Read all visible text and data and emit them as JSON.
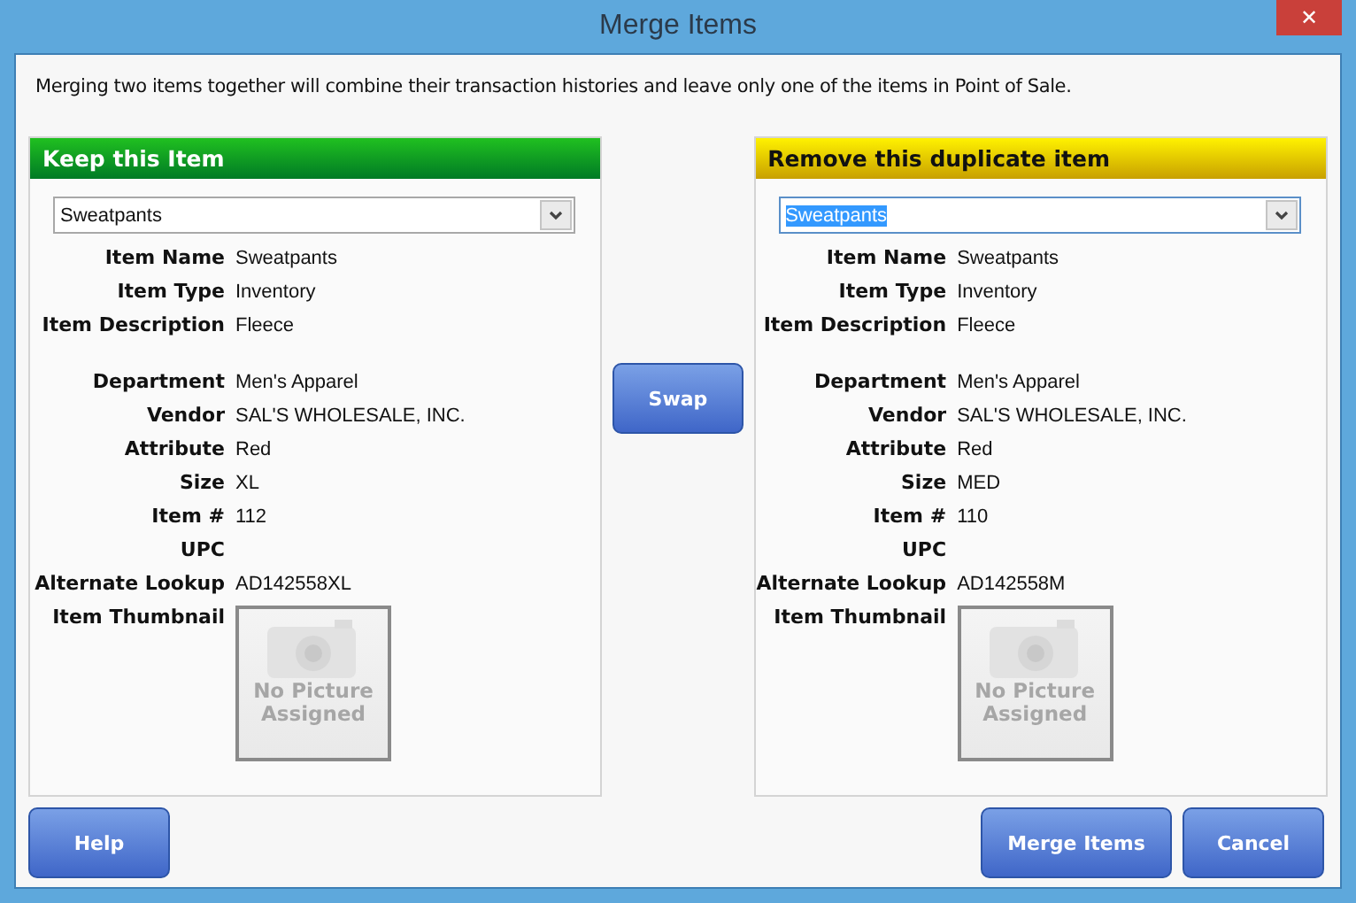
{
  "window": {
    "title": "Merge Items",
    "close": "✕"
  },
  "intro": "Merging two items together will combine their transaction histories and leave only one of the items in Point of Sale.",
  "panels": [
    {
      "kind": "keep",
      "title": "Keep this Item",
      "dropdown": {
        "value": "Sweatpants",
        "focused": false
      },
      "field_groups": [
        [
          {
            "label": "Item Name",
            "value": "Sweatpants"
          },
          {
            "label": "Item Type",
            "value": "Inventory"
          },
          {
            "label": "Item Description",
            "value": "Fleece"
          }
        ],
        [
          {
            "label": "Department",
            "value": "Men's Apparel"
          },
          {
            "label": "Vendor",
            "value": "SAL'S WHOLESALE, INC."
          },
          {
            "label": "Attribute",
            "value": "Red"
          },
          {
            "label": "Size",
            "value": "XL"
          },
          {
            "label": "Item #",
            "value": "112"
          },
          {
            "label": "UPC"
          },
          {
            "label": "Alternate Lookup",
            "value": "AD142558XL"
          }
        ]
      ],
      "thumbnail": {
        "label": "Item Thumbnail",
        "placeholder": "No Picture Assigned"
      }
    },
    {
      "kind": "remove",
      "title": "Remove this duplicate item",
      "dropdown": {
        "value": "Sweatpants",
        "focused": true
      },
      "field_groups": [
        [
          {
            "label": "Item Name",
            "value": "Sweatpants"
          },
          {
            "label": "Item Type",
            "value": "Inventory"
          },
          {
            "label": "Item Description",
            "value": "Fleece"
          }
        ],
        [
          {
            "label": "Department",
            "value": "Men's Apparel"
          },
          {
            "label": "Vendor",
            "value": "SAL'S WHOLESALE, INC."
          },
          {
            "label": "Attribute",
            "value": "Red"
          },
          {
            "label": "Size",
            "value": "MED"
          },
          {
            "label": "Item #",
            "value": "110"
          },
          {
            "label": "UPC"
          },
          {
            "label": "Alternate Lookup",
            "value": "AD142558M"
          }
        ]
      ],
      "thumbnail": {
        "label": "Item Thumbnail",
        "placeholder": "No Picture Assigned"
      }
    }
  ],
  "swap_button": "Swap",
  "buttons": {
    "left": [
      "Help"
    ],
    "right": [
      "Merge Items",
      "Cancel"
    ]
  }
}
